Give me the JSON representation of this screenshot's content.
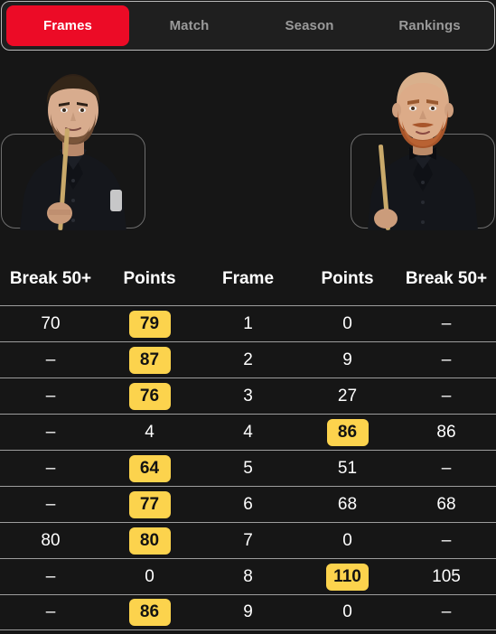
{
  "tabs": [
    {
      "label": "Frames",
      "active": true
    },
    {
      "label": "Match",
      "active": false
    },
    {
      "label": "Season",
      "active": false
    },
    {
      "label": "Rankings",
      "active": false
    }
  ],
  "colors": {
    "accent_red": "#ec0b26",
    "badge_yellow": "#fcd34d",
    "background": "#161616",
    "tabbar_background": "#1f1f1f",
    "divider": "#9d9d9d",
    "card_border": "#6e6e6e",
    "inactive_tab_text": "#9a9a9a"
  },
  "players": {
    "left": {
      "name": "left-player",
      "hair": "#2e2117",
      "skin": "#d8ac8e",
      "beard": "#6b4a33",
      "shirt": "#15171c",
      "cue": "#c9a96a"
    },
    "right": {
      "name": "right-player",
      "hair": "#d9b08c",
      "skin": "#dcab88",
      "beard": "#a8552a",
      "shirt": "#14161b",
      "cue": "#c9a96a"
    }
  },
  "table": {
    "headers": [
      "Break 50+",
      "Points",
      "Frame",
      "Points",
      "Break 50+"
    ],
    "rows": [
      {
        "break_left": "70",
        "points_left": "79",
        "points_left_highlight": true,
        "frame": "1",
        "points_right": "0",
        "points_right_highlight": false,
        "break_right": "–"
      },
      {
        "break_left": "–",
        "points_left": "87",
        "points_left_highlight": true,
        "frame": "2",
        "points_right": "9",
        "points_right_highlight": false,
        "break_right": "–"
      },
      {
        "break_left": "–",
        "points_left": "76",
        "points_left_highlight": true,
        "frame": "3",
        "points_right": "27",
        "points_right_highlight": false,
        "break_right": "–"
      },
      {
        "break_left": "–",
        "points_left": "4",
        "points_left_highlight": false,
        "frame": "4",
        "points_right": "86",
        "points_right_highlight": true,
        "break_right": "86"
      },
      {
        "break_left": "–",
        "points_left": "64",
        "points_left_highlight": true,
        "frame": "5",
        "points_right": "51",
        "points_right_highlight": false,
        "break_right": "–"
      },
      {
        "break_left": "–",
        "points_left": "77",
        "points_left_highlight": true,
        "frame": "6",
        "points_right": "68",
        "points_right_highlight": false,
        "break_right": "68"
      },
      {
        "break_left": "80",
        "points_left": "80",
        "points_left_highlight": true,
        "frame": "7",
        "points_right": "0",
        "points_right_highlight": false,
        "break_right": "–"
      },
      {
        "break_left": "–",
        "points_left": "0",
        "points_left_highlight": false,
        "frame": "8",
        "points_right": "110",
        "points_right_highlight": true,
        "break_right": "105"
      },
      {
        "break_left": "–",
        "points_left": "86",
        "points_left_highlight": true,
        "frame": "9",
        "points_right": "0",
        "points_right_highlight": false,
        "break_right": "–"
      }
    ]
  }
}
